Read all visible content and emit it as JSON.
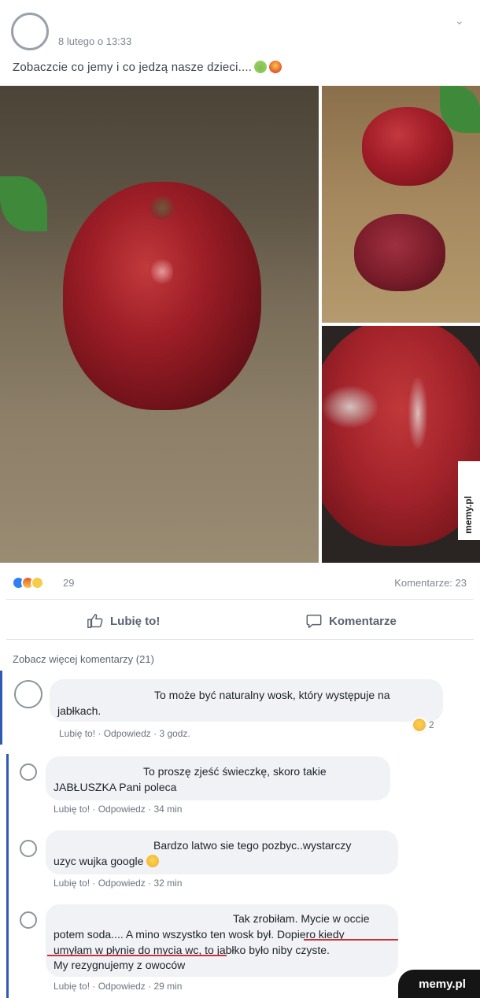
{
  "post": {
    "timestamp": "8 lutego o 13:33",
    "text": "Zobaczcie co jemy i co jedzą nasze dzieci....",
    "text_emoji": [
      "sick-face-icon",
      "angry-face-icon"
    ],
    "menu_icon": "chevron-down-icon"
  },
  "stats": {
    "reaction_icons": [
      "like-icon",
      "angry-icon",
      "sad-icon"
    ],
    "reaction_count": "29",
    "comments_label": "Komentarze: 23"
  },
  "actions": {
    "like_label": "Lubię to!",
    "comment_label": "Komentarze"
  },
  "comments_section": {
    "more_label": "Zobacz więcej komentarzy (21)"
  },
  "comments": [
    {
      "line1": "To może być naturalny wosk, który występuje na",
      "line2": "jabłkach.",
      "like": "Lubię to!",
      "reply": "Odpowiedz",
      "time": "3 godz.",
      "reaction_count": "2",
      "reaction_icon": "laugh-icon"
    },
    {
      "line1": "To proszę zjeść świeczkę, skoro takie",
      "line2": "JABŁUSZKA Pani poleca",
      "like": "Lubię to!",
      "reply": "Odpowiedz",
      "time": "34 min"
    },
    {
      "line1": "Bardzo latwo sie tego pozbyc..wystarczy",
      "line2": "uzyc wujka google",
      "line2_emoji": "smile-icon",
      "like": "Lubię to!",
      "reply": "Odpowiedz",
      "time": "32 min"
    },
    {
      "line1": "Tak zrobiłam. Mycie w occie",
      "line2": "potem soda.... A mino wszystko ten wosk był. Dopiero kiedy",
      "line3": "umyłam w płynie do mycia wc, to jabłko było niby czyste.",
      "line4": "My rezygnujemy z owoców",
      "like": "Lubię to!",
      "reply": "Odpowiedz",
      "time": "29 min"
    }
  ],
  "watermark": {
    "side": "memy.pl",
    "bottom": "memy.pl"
  }
}
